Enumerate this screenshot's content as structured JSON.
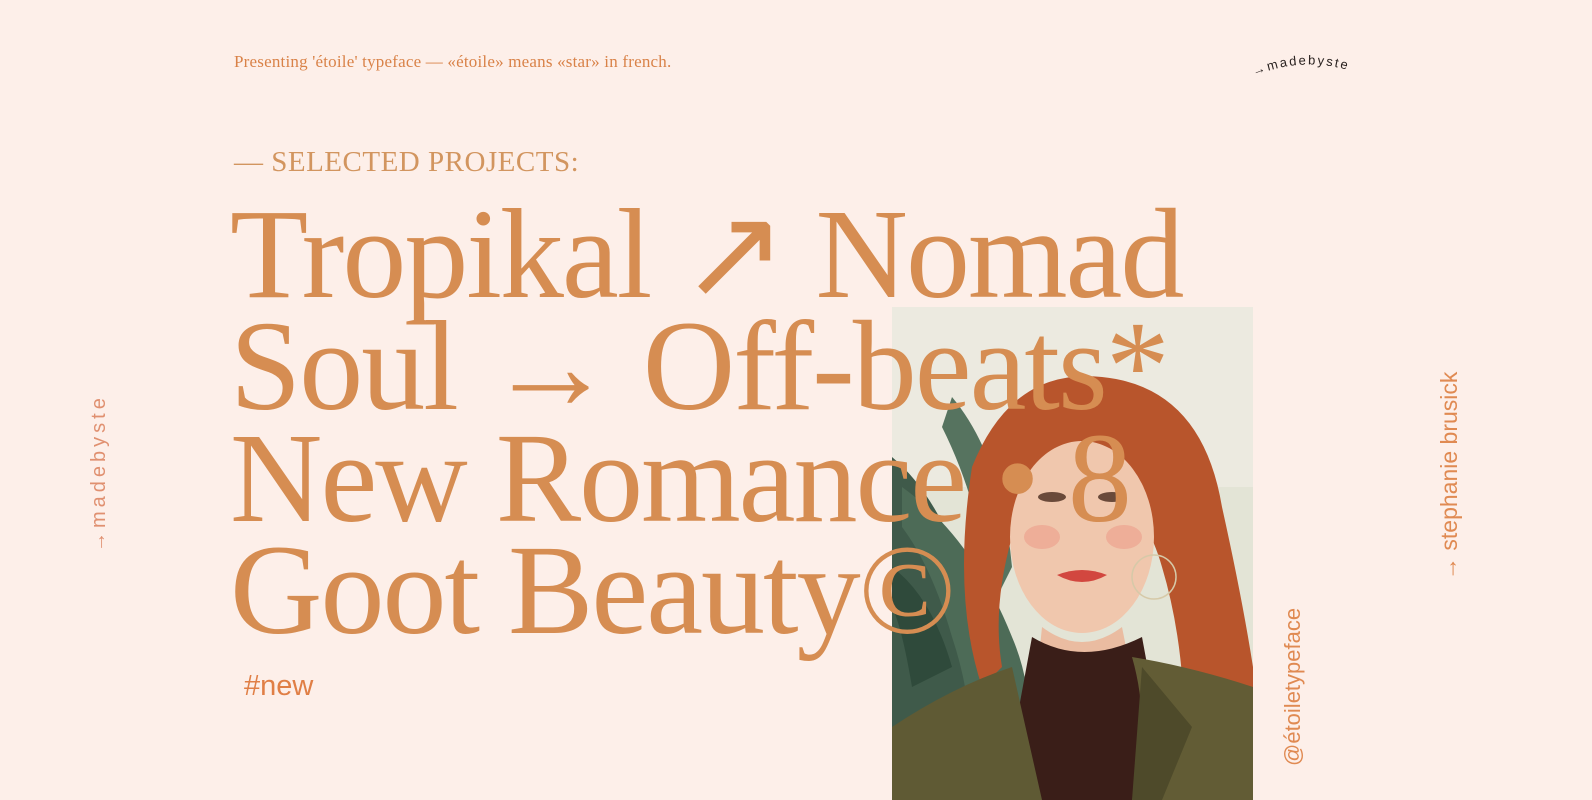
{
  "intro": "Presenting 'étoile' typeface — «étoile» means «star» in french.",
  "brand_top": "→madebyste",
  "section_title": "— SELECTED PROJECTS:",
  "headline": {
    "line1": "Tropikal ↗ Nomad",
    "line2": "Soul → Off-beats*",
    "line3": "New Romance • 8",
    "line4": "Goot Beauty©"
  },
  "tag": "#new",
  "vertical_handle": "@étoiletypeface",
  "vertical_author": "→ stephanie brusick",
  "vertical_left": "→madebyste",
  "photo_alt": "portrait with monstera leaf",
  "colors": {
    "background": "#fdefe9",
    "accent": "#d68d52"
  }
}
